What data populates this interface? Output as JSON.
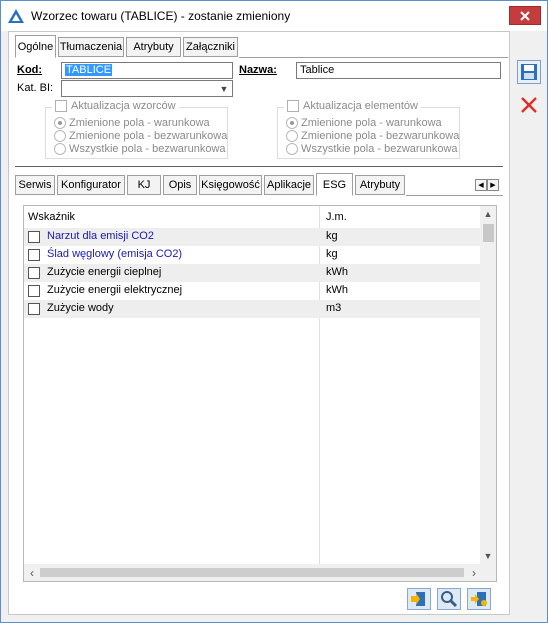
{
  "window": {
    "title": "Wzorzec towaru (TABLICE) - zostanie zmieniony"
  },
  "top_tabs": [
    {
      "label": "Ogólne"
    },
    {
      "label": "Tłumaczenia"
    },
    {
      "label": "Atrybuty"
    },
    {
      "label": "Załączniki"
    }
  ],
  "form": {
    "kod_label": "Kod:",
    "kod_value": "TABLICE",
    "nazwa_label": "Nazwa:",
    "nazwa_value": "Tablice",
    "kat_bi_label": "Kat. BI:",
    "kat_bi_value": ""
  },
  "group_wzorcow": {
    "title": "Aktualizacja wzorców",
    "options": [
      "Zmienione pola - warunkowa",
      "Zmienione pola - bezwarunkowa",
      "Wszystkie pola - bezwarunkowa"
    ]
  },
  "group_elementow": {
    "title": "Aktualizacja elementów",
    "options": [
      "Zmienione pola - warunkowa",
      "Zmienione pola - bezwarunkowa",
      "Wszystkie pola - bezwarunkowa"
    ]
  },
  "lower_tabs": [
    {
      "label": "Serwis"
    },
    {
      "label": "Konfigurator"
    },
    {
      "label": "KJ"
    },
    {
      "label": "Opis"
    },
    {
      "label": "Księgowość"
    },
    {
      "label": "Aplikacje"
    },
    {
      "label": "ESG"
    },
    {
      "label": "Atrybuty"
    }
  ],
  "grid": {
    "col_indicator": "Wskaźnik",
    "col_unit": "J.m.",
    "rows": [
      {
        "name": "Narzut dla emisji CO2",
        "unit": "kg"
      },
      {
        "name": "Ślad węglowy (emisja CO2)",
        "unit": "kg"
      },
      {
        "name": "Zużycie energii cieplnej",
        "unit": "kWh"
      },
      {
        "name": "Zużycie energii elektrycznej",
        "unit": "kWh"
      },
      {
        "name": "Zużycie wody",
        "unit": "m3"
      }
    ]
  },
  "colors": {
    "accent": "#3399ff",
    "link": "#1a1ab0",
    "close": "#c43c3c"
  }
}
